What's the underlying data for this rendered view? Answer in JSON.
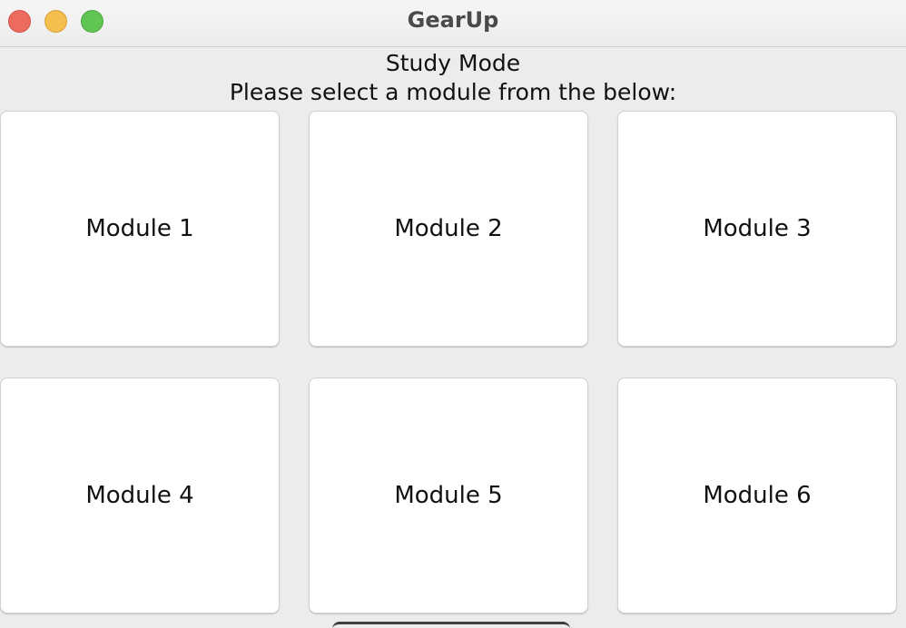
{
  "window": {
    "title": "GearUp",
    "controls": [
      "close",
      "minimize",
      "maximize"
    ]
  },
  "main": {
    "heading": "Study Mode",
    "subheading": "Please select a module from the below:",
    "modules": [
      {
        "label": "Module 1"
      },
      {
        "label": "Module 2"
      },
      {
        "label": "Module 3"
      },
      {
        "label": "Module 4"
      },
      {
        "label": "Module 5"
      },
      {
        "label": "Module 6"
      }
    ]
  }
}
